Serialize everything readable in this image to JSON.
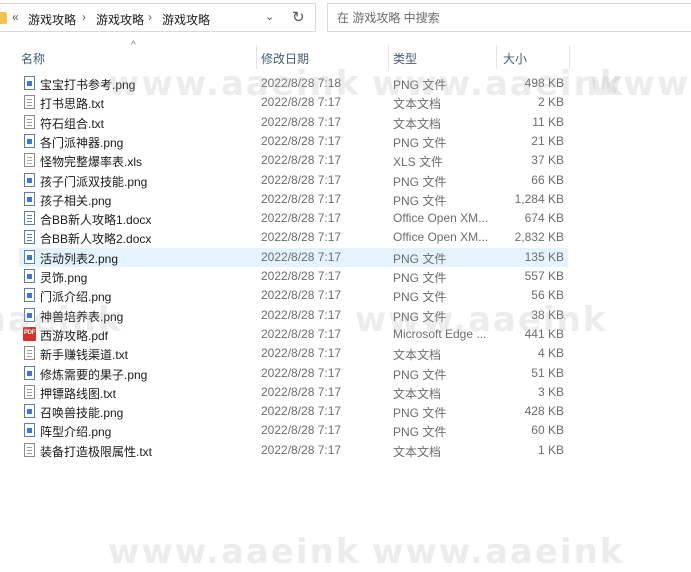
{
  "address": {
    "overflow": "«",
    "crumbs": [
      "游戏攻略",
      "游戏攻略",
      "游戏攻略"
    ],
    "separator": "›",
    "dropdown": "⌄",
    "refresh": "↻"
  },
  "search": {
    "placeholder": "在 游戏攻略 中搜索"
  },
  "columns": {
    "name": "名称",
    "date": "修改日期",
    "type": "类型",
    "size": "大小",
    "sort_indicator": "^"
  },
  "watermark": "www.aaeink",
  "files": [
    {
      "name": "宝宝打书参考.png",
      "date": "2022/8/28 7:18",
      "type": "PNG 文件",
      "size": "498 KB",
      "icon": "png-file-icon"
    },
    {
      "name": "打书思路.txt",
      "date": "2022/8/28 7:17",
      "type": "文本文档",
      "size": "2 KB",
      "icon": "txt-file-icon"
    },
    {
      "name": "符石组合.txt",
      "date": "2022/8/28 7:17",
      "type": "文本文档",
      "size": "11 KB",
      "icon": "txt-file-icon"
    },
    {
      "name": "各门派神器.png",
      "date": "2022/8/28 7:17",
      "type": "PNG 文件",
      "size": "21 KB",
      "icon": "png-file-icon"
    },
    {
      "name": "怪物完整爆率表.xls",
      "date": "2022/8/28 7:17",
      "type": "XLS 文件",
      "size": "37 KB",
      "icon": "xls-file-icon"
    },
    {
      "name": "孩子门派双技能.png",
      "date": "2022/8/28 7:17",
      "type": "PNG 文件",
      "size": "66 KB",
      "icon": "png-file-icon"
    },
    {
      "name": "孩子相关.png",
      "date": "2022/8/28 7:17",
      "type": "PNG 文件",
      "size": "1,284 KB",
      "icon": "png-file-icon"
    },
    {
      "name": "合BB新人攻略1.docx",
      "date": "2022/8/28 7:17",
      "type": "Office Open XM...",
      "size": "674 KB",
      "icon": "docx-file-icon"
    },
    {
      "name": "合BB新人攻略2.docx",
      "date": "2022/8/28 7:17",
      "type": "Office Open XM...",
      "size": "2,832 KB",
      "icon": "docx-file-icon"
    },
    {
      "name": "活动列表2.png",
      "date": "2022/8/28 7:17",
      "type": "PNG 文件",
      "size": "135 KB",
      "icon": "png-file-icon"
    },
    {
      "name": "灵饰.png",
      "date": "2022/8/28 7:17",
      "type": "PNG 文件",
      "size": "557 KB",
      "icon": "png-file-icon"
    },
    {
      "name": "门派介绍.png",
      "date": "2022/8/28 7:17",
      "type": "PNG 文件",
      "size": "56 KB",
      "icon": "png-file-icon"
    },
    {
      "name": "神兽培养表.png",
      "date": "2022/8/28 7:17",
      "type": "PNG 文件",
      "size": "38 KB",
      "icon": "png-file-icon"
    },
    {
      "name": "西游攻略.pdf",
      "date": "2022/8/28 7:17",
      "type": "Microsoft Edge ...",
      "size": "441 KB",
      "icon": "pdf-file-icon",
      "icon_text": "PDF"
    },
    {
      "name": "新手赚钱渠道.txt",
      "date": "2022/8/28 7:17",
      "type": "文本文档",
      "size": "4 KB",
      "icon": "txt-file-icon"
    },
    {
      "name": "修炼需要的果子.png",
      "date": "2022/8/28 7:17",
      "type": "PNG 文件",
      "size": "51 KB",
      "icon": "png-file-icon"
    },
    {
      "name": "押镖路线图.txt",
      "date": "2022/8/28 7:17",
      "type": "文本文档",
      "size": "3 KB",
      "icon": "txt-file-icon"
    },
    {
      "name": "召唤兽技能.png",
      "date": "2022/8/28 7:17",
      "type": "PNG 文件",
      "size": "428 KB",
      "icon": "png-file-icon"
    },
    {
      "name": "阵型介绍.png",
      "date": "2022/8/28 7:17",
      "type": "PNG 文件",
      "size": "60 KB",
      "icon": "png-file-icon"
    },
    {
      "name": "装备打造极限属性.txt",
      "date": "2022/8/28 7:17",
      "type": "文本文档",
      "size": "1 KB",
      "icon": "txt-file-icon"
    }
  ],
  "selected_index": 9
}
